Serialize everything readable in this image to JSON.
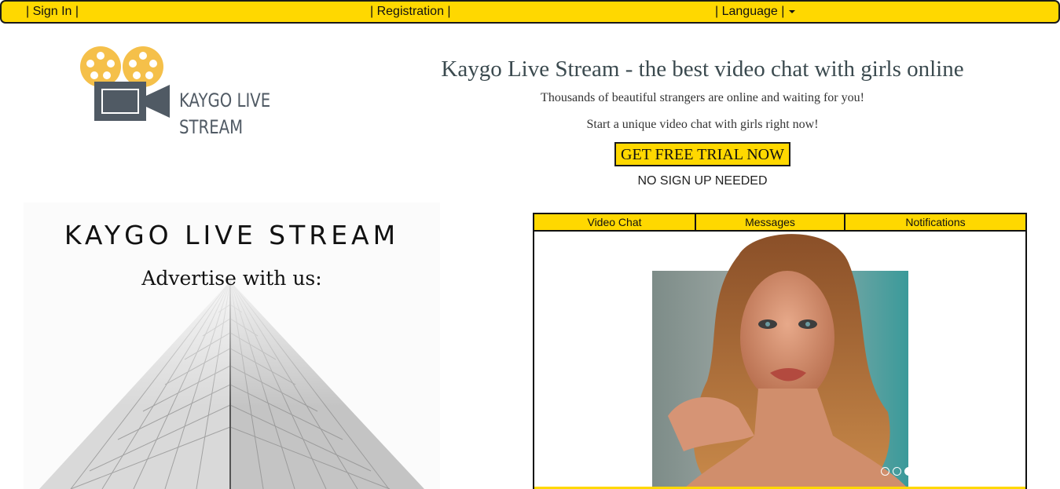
{
  "nav": {
    "sign_in": "| Sign In |",
    "registration": "| Registration |",
    "language": "| Language |"
  },
  "logo": {
    "line1": "KAYGO LIVE",
    "line2": "STREAM",
    "reel_color": "#f5c04a",
    "camera_color": "#505a64"
  },
  "hero": {
    "title": "Kaygo Live Stream - the best video chat with girls online",
    "subtitle": "Thousands of beautiful strangers are online and waiting for you!",
    "subtitle2": "Start a unique video chat with girls right now!",
    "cta": "GET FREE TRIAL NOW",
    "note": "NO SIGN UP NEEDED"
  },
  "ad": {
    "title": "KAYGO LIVE STREAM",
    "subtitle": "Advertise with us:"
  },
  "widget": {
    "tabs": [
      "Video Chat",
      "Messages",
      "Notifications"
    ],
    "carousel_active_index": 2
  },
  "colors": {
    "accent": "#ffd800",
    "border": "#111111"
  }
}
